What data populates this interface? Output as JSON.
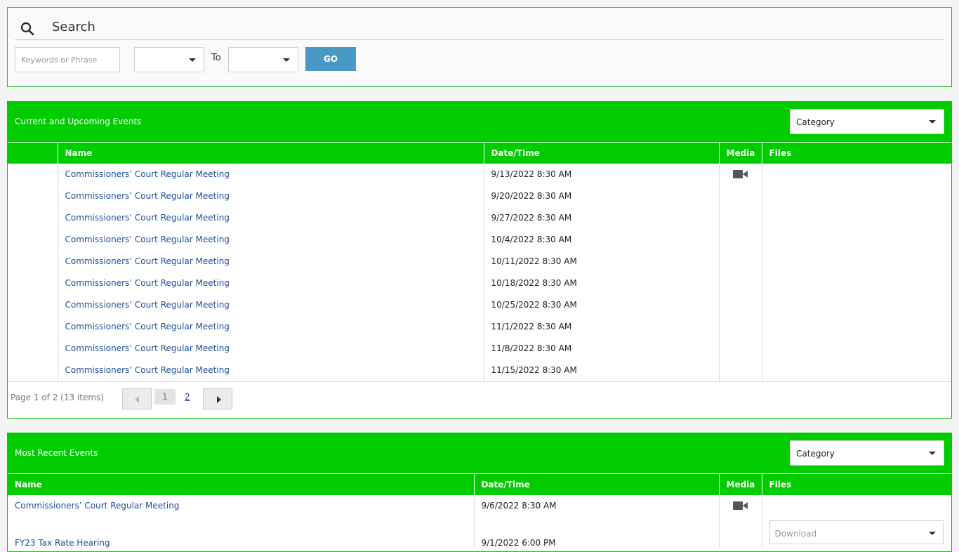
{
  "search": {
    "title": "Search",
    "keyword_placeholder": "Keywords or Phrase",
    "to_label": "To",
    "go_label": "GO"
  },
  "upcoming": {
    "title": "Current and Upcoming Events",
    "category_label": "Category",
    "columns": [
      "Name",
      "Date/Time",
      "Media",
      "Files"
    ],
    "rows": [
      {
        "name": "Commissioners’ Court Regular Meeting",
        "datetime": "9/13/2022 8:30 AM",
        "media": "video-icon"
      },
      {
        "name": "Commissioners’ Court Regular Meeting",
        "datetime": "9/20/2022 8:30 AM"
      },
      {
        "name": "Commissioners’ Court Regular Meeting",
        "datetime": "9/27/2022 8:30 AM"
      },
      {
        "name": "Commissioners’ Court Regular Meeting",
        "datetime": "10/4/2022 8:30 AM"
      },
      {
        "name": "Commissioners’ Court Regular Meeting",
        "datetime": "10/11/2022 8:30 AM"
      },
      {
        "name": "Commissioners’ Court Regular Meeting",
        "datetime": "10/18/2022 8:30 AM"
      },
      {
        "name": "Commissioners’ Court Regular Meeting",
        "datetime": "10/25/2022 8:30 AM"
      },
      {
        "name": "Commissioners’ Court Regular Meeting",
        "datetime": "11/1/2022 8:30 AM"
      },
      {
        "name": "Commissioners’ Court Regular Meeting",
        "datetime": "11/8/2022 8:30 AM"
      },
      {
        "name": "Commissioners’ Court Regular Meeting",
        "datetime": "11/15/2022 8:30 AM"
      }
    ],
    "pager": {
      "info": "Page 1 of 2 (13 items)",
      "current_page": "1",
      "next_page": "2"
    }
  },
  "recent": {
    "title": "Most Recent Events",
    "category_label": "Category",
    "columns": [
      "Name",
      "Date/Time",
      "Media",
      "Files"
    ],
    "rows": [
      {
        "name": "Commissioners’ Court Regular Meeting",
        "datetime": "9/6/2022 8:30 AM",
        "media": "video-icon"
      },
      {
        "name": "FY23 Tax Rate Hearing",
        "datetime": "9/1/2022 6:00 PM",
        "files": "Download"
      }
    ]
  },
  "colors": {
    "header_green": "#00cc00",
    "go_button": "#4a99c4",
    "link": "#1f4f9b"
  }
}
